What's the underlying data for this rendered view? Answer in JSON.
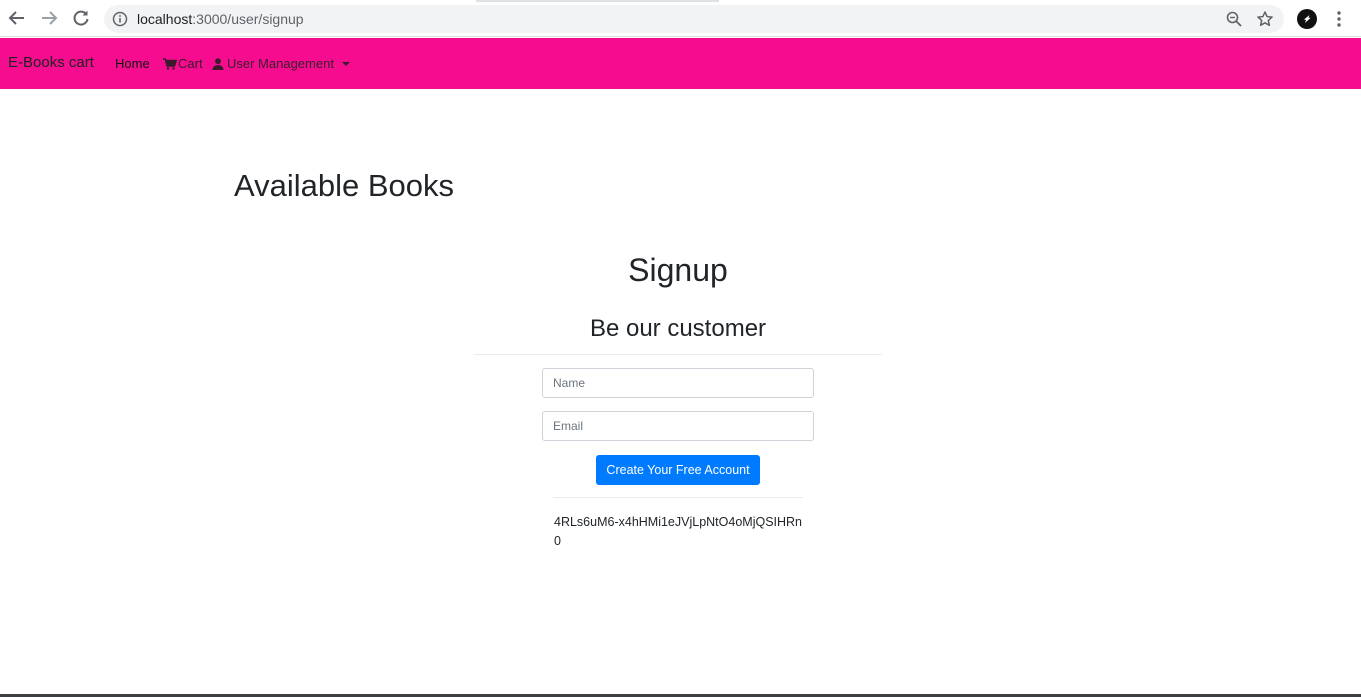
{
  "browser": {
    "url_host": "localhost",
    "url_path": ":3000/user/signup"
  },
  "navbar": {
    "brand": "E-Books cart",
    "home_label": "Home",
    "cart_label": "Cart",
    "user_management_label": "User Management",
    "background_color": "#f50c8f"
  },
  "main": {
    "heading": "Available Books"
  },
  "signup_form": {
    "title": "Signup",
    "subtitle": "Be our customer",
    "name_placeholder": "Name",
    "name_value": "",
    "email_placeholder": "Email",
    "email_value": "",
    "submit_label": "Create Your Free Account",
    "submit_color": "#007bff",
    "token_text": "4RLs6uM6-x4hHMi1eJVjLpNtO4oMjQSIHRn0"
  }
}
